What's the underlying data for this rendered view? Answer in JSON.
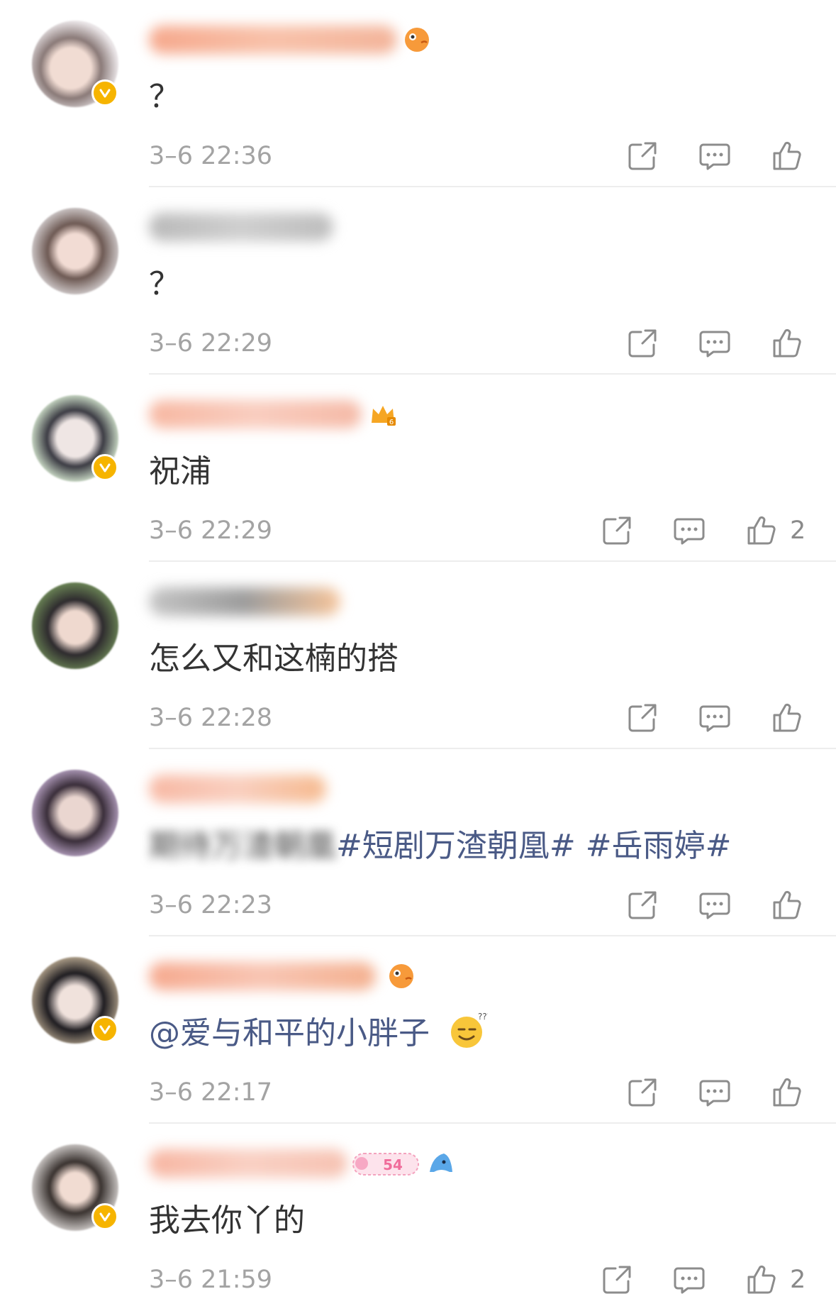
{
  "icons": {
    "share": "share-icon",
    "reply": "comment-icon",
    "like": "thumbs-up-icon",
    "verified": "verified-v-icon"
  },
  "colors": {
    "topic_link": "#4a5a86",
    "timestamp": "#a3a3a3",
    "verified": "#f6b400"
  },
  "comments": [
    {
      "text": "？",
      "time": "3–6 22:36",
      "likes": ""
    },
    {
      "text": "？",
      "time": "3–6 22:29",
      "likes": ""
    },
    {
      "text": "祝浦",
      "time": "3–6 22:29",
      "likes": "2"
    },
    {
      "text": "怎么又和这楠的搭",
      "time": "3–6 22:28",
      "likes": ""
    },
    {
      "text_blurred": "期待万渣朝凰",
      "topic1": "#短剧万渣朝凰#",
      "topic2": "#岳雨婷#",
      "time": "3–6 22:23",
      "likes": ""
    },
    {
      "mention": "@爱与和平的小胖子",
      "time": "3–6 22:17",
      "likes": ""
    },
    {
      "text": "我去你丫的",
      "time": "3–6 21:59",
      "likes": "2"
    }
  ]
}
